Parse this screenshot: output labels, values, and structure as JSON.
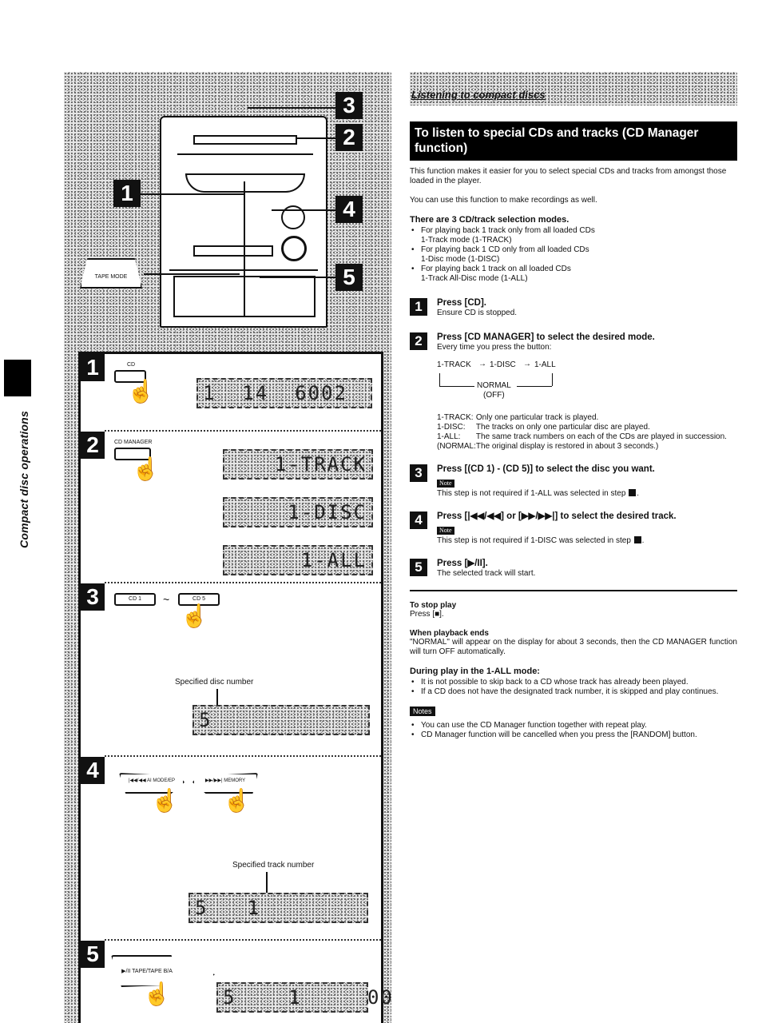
{
  "side_tab": {
    "label": "Compact disc operations"
  },
  "illustration": {
    "callouts": [
      "1",
      "2",
      "3",
      "4",
      "5"
    ],
    "tape_mode_button": "TAPE MODE",
    "steps": [
      {
        "num": "1",
        "button_label": "CD",
        "lcd": [
          "1  14  6002"
        ]
      },
      {
        "num": "2",
        "button_label": "CD MANAGER",
        "lcd": [
          "1-TRACK",
          "1-DISC",
          "1-ALL"
        ]
      },
      {
        "num": "3",
        "button_label_first": "CD 1",
        "button_label_last": "CD 5",
        "tilde": "~",
        "pointer_label": "Specified disc number",
        "lcd": [
          "5"
        ]
      },
      {
        "num": "4",
        "button_label_left": "|◀◀/◀◀ AI MODE/EP",
        "button_label_right": "▶▶/▶▶| MEMORY",
        "pointer_label": "Specified track number",
        "lcd": [
          "5   1"
        ]
      },
      {
        "num": "5",
        "button_label": "▶/II TAPE/TAPE B/A",
        "lcd": [
          "5    1     00"
        ]
      }
    ]
  },
  "content": {
    "section_title": "Listening to compact discs",
    "feature_title": "To listen to special CDs and tracks (CD Manager function)",
    "intro": "This function makes it easier for you to select special CDs and tracks from amongst those loaded in the player.",
    "intro2": "You can use this function to make recordings as well.",
    "modes_heading": "There are 3 CD/track selection modes.",
    "modes": [
      {
        "line1": "For playing back 1 track only from all loaded CDs",
        "line2": "1-Track mode (1-TRACK)"
      },
      {
        "line1": "For playing back 1 CD only from all loaded CDs",
        "line2": "1-Disc mode (1-DISC)"
      },
      {
        "line1": "For playing back 1 track on all loaded CDs",
        "line2": "1-Track All-Disc mode (1-ALL)"
      }
    ],
    "steps": [
      {
        "num": "1",
        "title": "Press [CD].",
        "sub": "Ensure CD is stopped."
      },
      {
        "num": "2",
        "title": "Press [CD MANAGER] to select the desired mode.",
        "sub": "Every time you press the button:"
      },
      {
        "num": "3",
        "title": "Press [(CD 1) - (CD 5)] to select the disc you want.",
        "note_label": "Note",
        "note": "This step is not required if 1-ALL was selected in step",
        "note_ref": "2"
      },
      {
        "num": "4",
        "title": "Press [|◀◀/◀◀] or [▶▶/▶▶|] to select the desired track.",
        "note_label": "Note",
        "note": "This step is not required if 1-DISC was selected in step",
        "note_ref": "2"
      },
      {
        "num": "5",
        "title": "Press [▶/II].",
        "sub": "The selected track will start."
      }
    ],
    "cycle": {
      "item1": "1-TRACK",
      "item2": "1-DISC",
      "item3": "1-ALL",
      "normal": "NORMAL",
      "off": "(OFF)",
      "arrow": "→"
    },
    "definitions": [
      {
        "term": "1-TRACK:",
        "text": "Only one particular track is played."
      },
      {
        "term": "1-DISC:",
        "text": "The tracks on only one particular disc are played."
      },
      {
        "term": "1-ALL:",
        "text": "The same track numbers on each of the CDs are played in succession."
      },
      {
        "term": "(NORMAL:",
        "text": "The original display is restored in about 3 seconds.)"
      }
    ],
    "stop": {
      "heading": "To stop play",
      "text": "Press [■]."
    },
    "ends": {
      "heading": "When playback ends",
      "text": "\"NORMAL\" will appear on the display for about 3 seconds, then the CD MANAGER function will turn OFF automatically."
    },
    "during": {
      "heading": "During play in the 1-ALL mode:",
      "items": [
        "It is not possible to skip back to a CD whose track has already been played.",
        "If a CD does not have the designated track number, it is skipped and play continues."
      ]
    },
    "notes": {
      "label": "Notes",
      "items": [
        "You can use the CD Manager function together with repeat play.",
        "CD Manager function will be cancelled when you press the [RANDOM] button."
      ]
    }
  }
}
